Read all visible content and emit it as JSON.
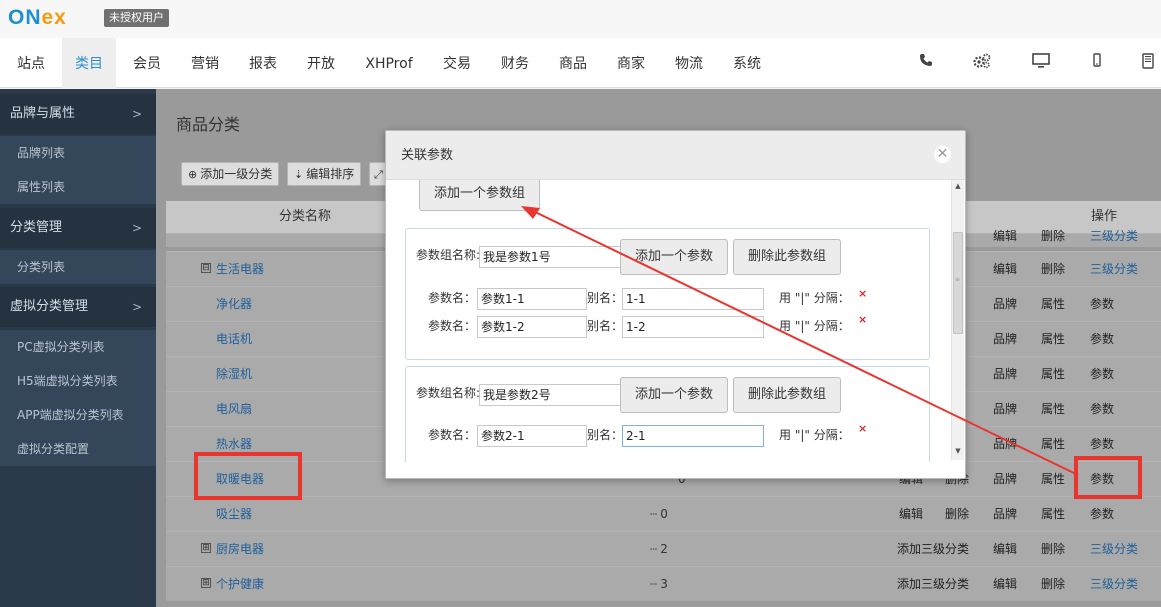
{
  "logo": {
    "part1": "ON",
    "part2": "ex",
    "badge": "未授权用户"
  },
  "top_nav": {
    "items": [
      "站点",
      "类目",
      "会员",
      "营销",
      "报表",
      "开放",
      "XHProf",
      "交易",
      "财务",
      "商品",
      "商家",
      "物流",
      "系统"
    ],
    "active": "类目",
    "icons": [
      "phone-icon",
      "settings-cogs-icon",
      "desktop-icon",
      "mobile-icon",
      "tablet-icon"
    ]
  },
  "sidebar": {
    "sections": [
      {
        "title": "品牌与属性",
        "items": [
          "品牌列表",
          "属性列表"
        ]
      },
      {
        "title": "分类管理",
        "items": [
          "分类列表"
        ]
      },
      {
        "title": "虚拟分类管理",
        "items": [
          "PC虚拟分类列表",
          "H5端虚拟分类列表",
          "APP端虚拟分类列表",
          "虚拟分类配置"
        ]
      }
    ]
  },
  "main": {
    "title": "商品分类",
    "toolbar": {
      "add_top": "添加一级分类",
      "edit_sort": "编辑排序"
    },
    "table": {
      "col_name": "分类名称",
      "col_actions": "操作",
      "rows": [
        {
          "name": "生活电器",
          "expander": "⊟",
          "actions": [
            "编辑",
            "删除",
            "三级分类"
          ]
        },
        {
          "name": "净化器",
          "actions": [
            "品牌",
            "属性",
            "参数"
          ]
        },
        {
          "name": "电话机",
          "actions": [
            "品牌",
            "属性",
            "参数"
          ]
        },
        {
          "name": "除湿机",
          "actions": [
            "品牌",
            "属性",
            "参数"
          ]
        },
        {
          "name": "电风扇",
          "actions": [
            "品牌",
            "属性",
            "参数"
          ]
        },
        {
          "name": "热水器",
          "actions": [
            "品牌",
            "属性",
            "参数"
          ]
        },
        {
          "name": "取暖电器",
          "sort": "0",
          "actions": [
            "编辑",
            "删除",
            "品牌",
            "属性",
            "参数"
          ]
        },
        {
          "name": "吸尘器",
          "sort": "0",
          "actions": [
            "编辑",
            "删除",
            "品牌",
            "属性",
            "参数"
          ]
        },
        {
          "name": "厨房电器",
          "expander": "⊞",
          "sort": "2",
          "actions": [
            "添加三级分类",
            "编辑",
            "删除",
            "三级分类"
          ]
        },
        {
          "name": "个护健康",
          "expander": "⊞",
          "sort": "3",
          "actions": [
            "添加三级分类",
            "编辑",
            "删除",
            "三级分类"
          ]
        }
      ]
    }
  },
  "modal": {
    "title": "关联参数",
    "add_group_button": "添加一个参数组",
    "group_name_label": "参数组名称:",
    "add_param_button": "添加一个参数",
    "delete_group_button": "删除此参数组",
    "param_name_label": "参数名：",
    "alias_label": "别名：",
    "separator_hint": "用 \"|\" 分隔：",
    "delete_mark": "×",
    "groups": [
      {
        "name": "我是参数1号",
        "params": [
          {
            "name": "参数1-1",
            "alias": "1-1"
          },
          {
            "name": "参数1-2",
            "alias": "1-2"
          }
        ]
      },
      {
        "name": "我是参数2号",
        "params": [
          {
            "name": "参数2-1",
            "alias": "2-1"
          }
        ]
      }
    ]
  },
  "colors": {
    "accent": "#2c90d0",
    "highlight_box": "#e8352e",
    "sidebar_bg": "#2b3a4a"
  }
}
